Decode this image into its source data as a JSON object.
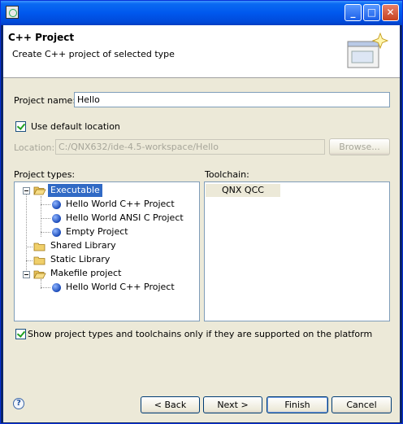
{
  "window": {
    "title": "",
    "min_glyph": "_",
    "max_glyph": "□",
    "close_glyph": "✕"
  },
  "header": {
    "title": "C++ Project",
    "subtitle": "Create C++ project of selected type"
  },
  "form": {
    "project_name_label": "Project name:",
    "project_name_value": "Hello",
    "use_default_location_label": "Use default location",
    "use_default_location_checked": true,
    "location_label": "Location:",
    "location_value": "C:/QNX632/ide-4.5-workspace/Hello",
    "browse_label": "Browse..."
  },
  "project_types": {
    "label": "Project types:",
    "items": [
      {
        "label": "Executable",
        "kind": "folder",
        "expanded": true,
        "selected": true
      },
      {
        "label": "Hello World C++ Project",
        "kind": "template"
      },
      {
        "label": "Hello World ANSI C Project",
        "kind": "template"
      },
      {
        "label": "Empty Project",
        "kind": "template"
      },
      {
        "label": "Shared Library",
        "kind": "folder"
      },
      {
        "label": "Static Library",
        "kind": "folder"
      },
      {
        "label": "Makefile project",
        "kind": "folder",
        "expanded": true
      },
      {
        "label": "Hello World C++ Project",
        "kind": "template"
      }
    ]
  },
  "toolchain": {
    "label": "Toolchain:",
    "items": [
      "QNX QCC"
    ]
  },
  "filter": {
    "label": "Show project types and toolchains only if they are supported on the platform",
    "checked": true
  },
  "buttons": {
    "back": "< Back",
    "next": "Next >",
    "finish": "Finish",
    "cancel": "Cancel",
    "help": "?"
  },
  "colors": {
    "selection": "#316ac5",
    "dialog_bg": "#ece9d8",
    "titlebar": "#0058ee"
  }
}
